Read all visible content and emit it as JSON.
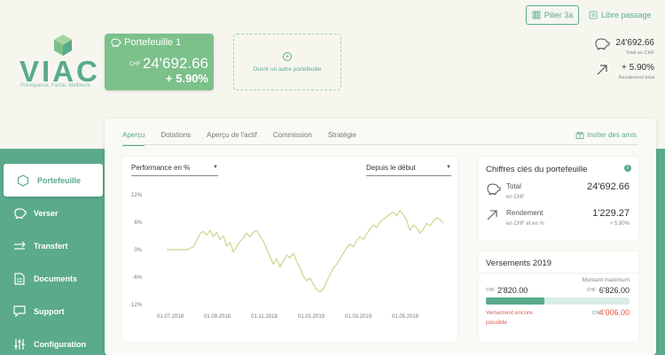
{
  "brand": {
    "name": "VIAC",
    "tagline": "Prévoyance. Facile. Meilleure."
  },
  "portfolio_card": {
    "name": "Portefeuille 1",
    "currency": "CHF",
    "value": "24'692.66",
    "performance": "+ 5.90%"
  },
  "add_portfolio": {
    "label": "Ouvrir un autre portefeuille"
  },
  "top_buttons": {
    "pillar": "Pilier 3a",
    "libre": "Libre passage"
  },
  "summary": {
    "total": "24'692.66",
    "total_label": "Total en CHF",
    "performance": "+ 5.90%",
    "performance_label": "Rendement total"
  },
  "tabs": [
    {
      "label": "Aperçu"
    },
    {
      "label": "Dotations"
    },
    {
      "label": "Aperçu de l'actif"
    },
    {
      "label": "Commission"
    },
    {
      "label": "Stratégie"
    }
  ],
  "invite": "Inviter des amis",
  "chart_controls": {
    "metric": "Performance en %",
    "range": "Depuis le début"
  },
  "chart_data": {
    "type": "line",
    "title": "",
    "xlabel": "",
    "ylabel": "",
    "ylim": [
      -12,
      12
    ],
    "y_ticks": [
      "12%",
      "6%",
      "0%",
      "-6%",
      "-12%"
    ],
    "x_ticks": [
      "01.07.2018",
      "01.09.2018",
      "01.11.2018",
      "01.01.2019",
      "01.03.2019",
      "01.05.2019"
    ],
    "series": [
      {
        "color": "#cfdc9a",
        "points": [
          [
            0,
            0
          ],
          [
            3,
            0
          ],
          [
            6,
            0
          ],
          [
            8,
            0.6
          ],
          [
            9,
            2.0
          ],
          [
            10,
            3.5
          ],
          [
            11,
            4.0
          ],
          [
            12,
            3.2
          ],
          [
            13,
            4.2
          ],
          [
            14,
            2.8
          ],
          [
            15,
            3.8
          ],
          [
            16,
            2.2
          ],
          [
            17,
            3.0
          ],
          [
            18,
            0.8
          ],
          [
            19,
            1.6
          ],
          [
            20,
            -0.5
          ],
          [
            21,
            0.6
          ],
          [
            22,
            1.8
          ],
          [
            23,
            2.6
          ],
          [
            24,
            3.6
          ],
          [
            25,
            2.8
          ],
          [
            26,
            3.8
          ],
          [
            27,
            4.2
          ],
          [
            28,
            3.0
          ],
          [
            29,
            1.8
          ],
          [
            30,
            0.2
          ],
          [
            31,
            -1.5
          ],
          [
            32,
            -3.2
          ],
          [
            33,
            -2.0
          ],
          [
            34,
            -3.8
          ],
          [
            35,
            -2.5
          ],
          [
            36,
            -1.2
          ],
          [
            37,
            -1.8
          ],
          [
            38,
            -0.8
          ],
          [
            39,
            -2.6
          ],
          [
            40,
            -4.0
          ],
          [
            41,
            -5.8
          ],
          [
            42,
            -6.8
          ],
          [
            43,
            -6.2
          ],
          [
            44,
            -7.5
          ],
          [
            45,
            -8.8
          ],
          [
            46,
            -9.2
          ],
          [
            47,
            -8.6
          ],
          [
            48,
            -7.0
          ],
          [
            49,
            -5.5
          ],
          [
            50,
            -4.0
          ],
          [
            51,
            -3.2
          ],
          [
            52,
            -2.0
          ],
          [
            53,
            -0.8
          ],
          [
            54,
            0.4
          ],
          [
            55,
            1.2
          ],
          [
            56,
            0.6
          ],
          [
            57,
            2.0
          ],
          [
            58,
            2.8
          ],
          [
            59,
            2.2
          ],
          [
            60,
            3.4
          ],
          [
            61,
            4.6
          ],
          [
            62,
            5.4
          ],
          [
            63,
            4.8
          ],
          [
            64,
            6.0
          ],
          [
            65,
            6.6
          ],
          [
            66,
            7.2
          ],
          [
            67,
            7.8
          ],
          [
            68,
            8.2
          ],
          [
            69,
            7.4
          ],
          [
            70,
            8.6
          ],
          [
            71,
            7.6
          ],
          [
            72,
            6.4
          ],
          [
            73,
            4.2
          ],
          [
            74,
            5.4
          ],
          [
            75,
            4.8
          ],
          [
            76,
            3.6
          ],
          [
            77,
            4.4
          ],
          [
            78,
            5.8
          ],
          [
            79,
            5.2
          ],
          [
            80,
            6.2
          ],
          [
            81,
            7.0
          ],
          [
            82,
            6.6
          ],
          [
            83,
            5.8
          ]
        ]
      }
    ]
  },
  "key_figures": {
    "title": "Chiffres clés du portefeuille",
    "total_label": "Total",
    "total_sub": "en CHF",
    "total_value": "24'692.66",
    "perf_label": "Rendement",
    "perf_sub": "en CHF et en %",
    "perf_value": "1'229.27",
    "perf_pct": "+ 5.90%"
  },
  "contributions": {
    "title": "Versements 2019",
    "max_label": "Montant maximum",
    "currency": "CHF",
    "current": "2'820.00",
    "maximum": "6'826.00",
    "progress": 0.41,
    "remaining_label": "Versement encore possible",
    "remaining": "4'006.00"
  },
  "sidebar": {
    "items": [
      {
        "label": "Portefeuille",
        "icon": "hexagon-icon"
      },
      {
        "label": "Verser",
        "icon": "piggy-bank-icon"
      },
      {
        "label": "Transfert",
        "icon": "transfer-arrows-icon"
      },
      {
        "label": "Documents",
        "icon": "document-icon"
      },
      {
        "label": "Support",
        "icon": "chat-bubble-icon"
      },
      {
        "label": "Configuration",
        "icon": "sliders-icon"
      }
    ]
  },
  "colors": {
    "brand_green": "#5aaa8b",
    "card_green": "#7cc08a",
    "background": "#f6f6ef",
    "warning_red": "#e05a4e",
    "chart_line": "#cfdc9a"
  }
}
